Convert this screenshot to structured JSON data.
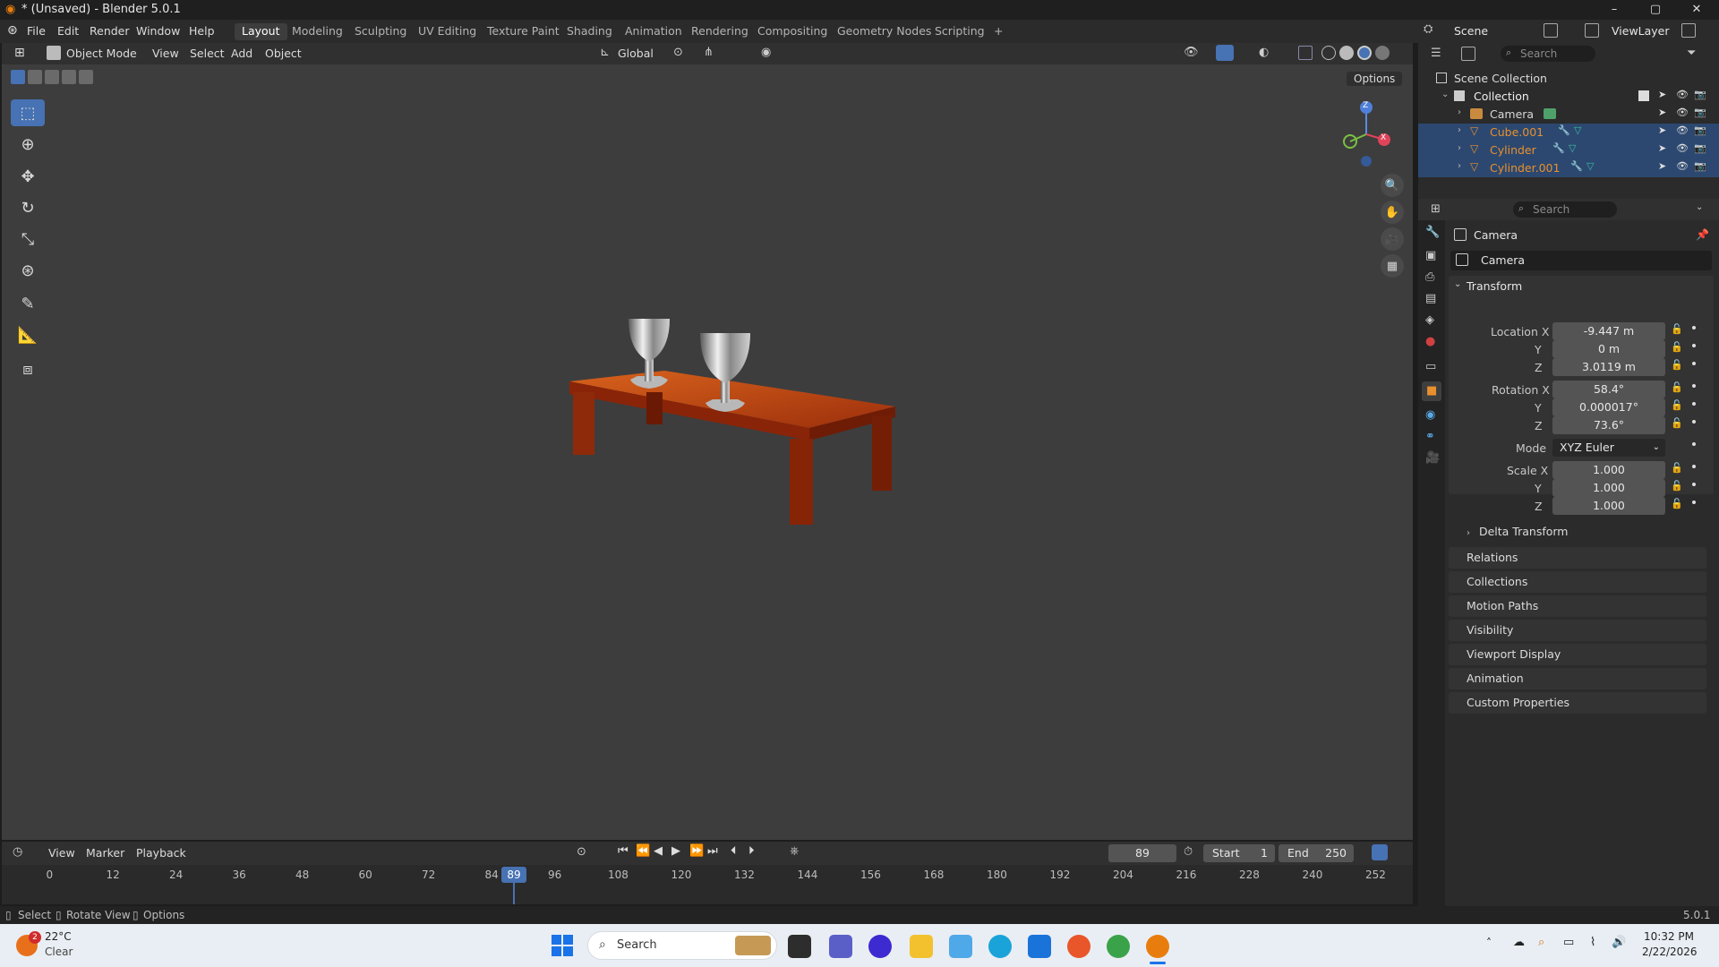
{
  "window": {
    "title": "* (Unsaved) - Blender 5.0.1",
    "minimize": "–",
    "maximize": "▢",
    "close": "✕"
  },
  "menubar": {
    "menus": [
      "File",
      "Edit",
      "Render",
      "Window",
      "Help"
    ],
    "workspaces": [
      "Layout",
      "Modeling",
      "Sculpting",
      "UV Editing",
      "Texture Paint",
      "Shading",
      "Animation",
      "Rendering",
      "Compositing",
      "Geometry Nodes",
      "Scripting"
    ],
    "active_workspace": "Layout",
    "add_workspace": "+",
    "scene_label": "Scene",
    "viewlayer_label": "ViewLayer"
  },
  "viewport_header": {
    "mode": "Object Mode",
    "menus": [
      "View",
      "Select",
      "Add",
      "Object"
    ],
    "orientation": "Global",
    "options": "Options"
  },
  "gizmo": {
    "z": "Z",
    "y": "Y",
    "x": "X"
  },
  "outliner": {
    "search_placeholder": "Search",
    "root": "Scene Collection",
    "collection": "Collection",
    "items": [
      {
        "name": "Camera",
        "selected": false,
        "color": "#d9d9d9"
      },
      {
        "name": "Cube.001",
        "selected": true,
        "color": "#e8902e"
      },
      {
        "name": "Cylinder",
        "selected": true,
        "color": "#e8902e"
      },
      {
        "name": "Cylinder.001",
        "selected": true,
        "color": "#e8902e"
      }
    ]
  },
  "properties": {
    "search_placeholder": "Search",
    "object_name": "Camera",
    "object_field": "Camera",
    "transform_label": "Transform",
    "location_label": "Location X",
    "location": [
      "-9.447 m",
      "0 m",
      "3.0119 m"
    ],
    "rotation_label": "Rotation X",
    "rotation": [
      "58.4°",
      "0.000017°",
      "73.6°"
    ],
    "axis_y": "Y",
    "axis_z": "Z",
    "mode_label": "Mode",
    "mode_value": "XYZ Euler",
    "scale_label": "Scale X",
    "scale": [
      "1.000",
      "1.000",
      "1.000"
    ],
    "delta_transform": "Delta Transform",
    "sections": [
      "Relations",
      "Collections",
      "Motion Paths",
      "Visibility",
      "Viewport Display",
      "Animation",
      "Custom Properties"
    ]
  },
  "timeline": {
    "menus": [
      "View",
      "Marker",
      "Playback"
    ],
    "current_frame": "89",
    "start_label": "Start",
    "start": "1",
    "end_label": "End",
    "end": "250",
    "ticks": [
      "0",
      "12",
      "24",
      "36",
      "48",
      "60",
      "72",
      "84",
      "96",
      "108",
      "120",
      "132",
      "144",
      "156",
      "168",
      "180",
      "192",
      "204",
      "216",
      "228",
      "240",
      "252"
    ]
  },
  "statusbar": {
    "select": "Select",
    "rotate": "Rotate View",
    "options": "Options",
    "version": "5.0.1"
  },
  "taskbar": {
    "weather_temp": "22°C",
    "weather_desc": "Clear",
    "weather_badge": "2",
    "search": "Search",
    "time": "10:32 PM",
    "date": "2/22/2026"
  }
}
